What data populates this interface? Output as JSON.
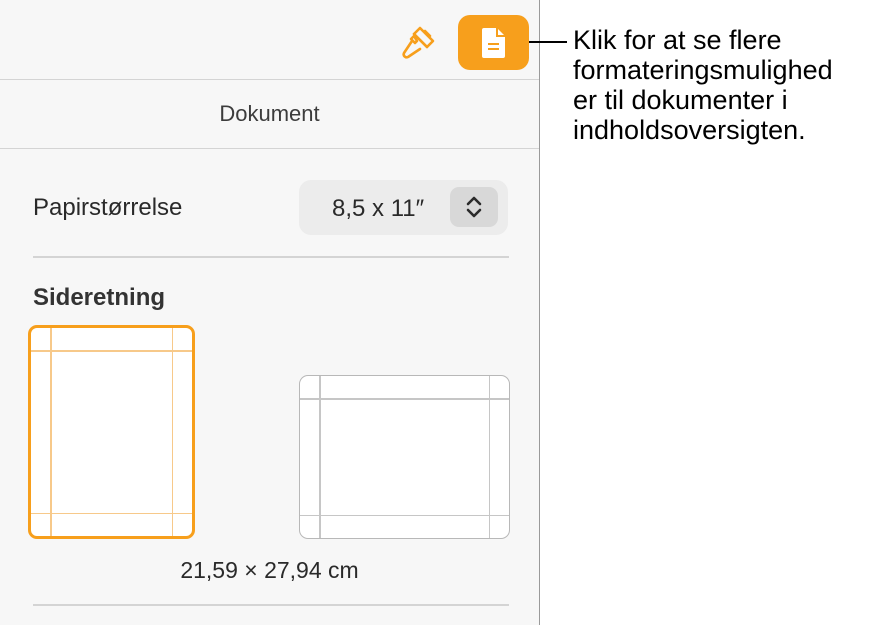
{
  "colors": {
    "accent": "#f79f1c",
    "panel_bg": "#f7f7f7",
    "unselected_border": "#b8b8b8",
    "guide_selected": "#f7c98a",
    "guide_unselected": "#c6c6c6"
  },
  "toolbar": {
    "format_icon": "paintbrush-icon",
    "document_icon": "document-icon"
  },
  "section": {
    "title": "Dokument"
  },
  "paper_size": {
    "label": "Papirstørrelse",
    "value": "8,5 x 11″"
  },
  "orientation": {
    "heading": "Sideretning",
    "selected": "portrait",
    "dimensions": "21,59 × 27,94 cm"
  },
  "callout": {
    "lines": [
      "Klik for at se flere",
      "formateringsmulighed",
      "er til dokumenter i",
      "indholdsoversigten."
    ]
  }
}
